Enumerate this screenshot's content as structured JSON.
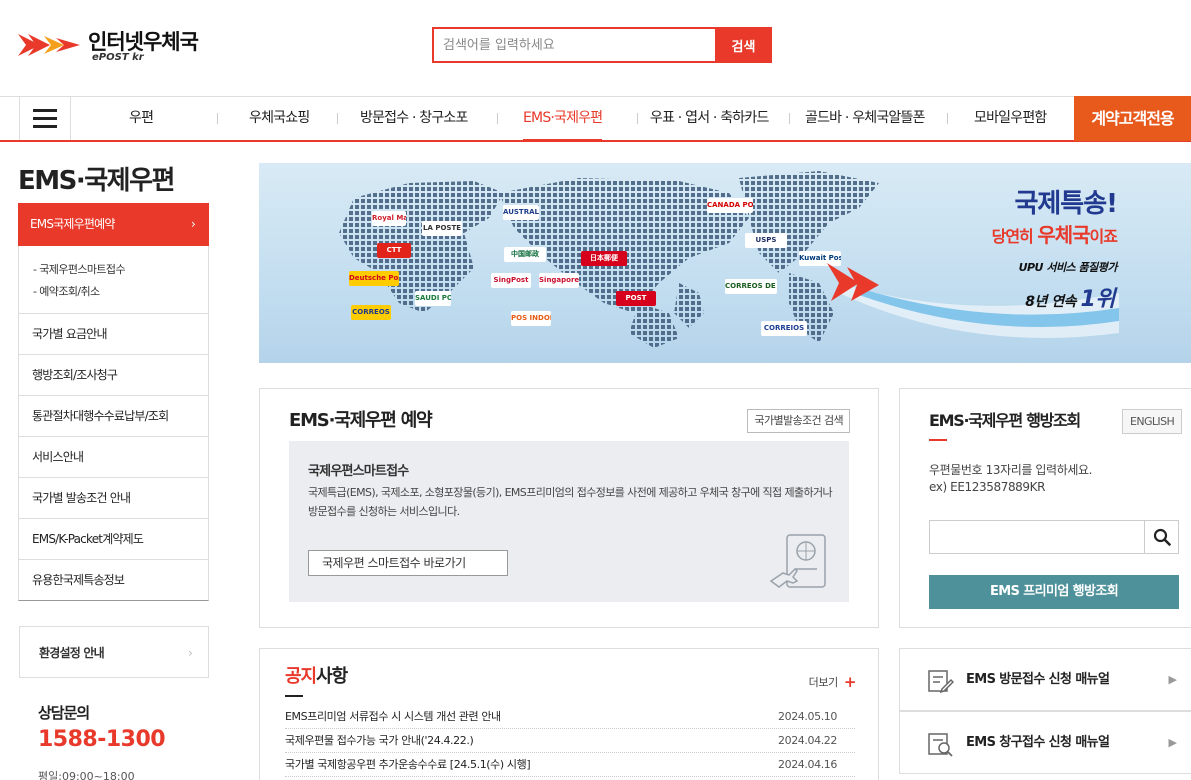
{
  "header": {
    "logo_name": "인터넷우체국",
    "logo_sub": "ePOST kr",
    "search_placeholder": "검색어를 입력하세요",
    "search_button": "검색"
  },
  "gnb": {
    "items": [
      "우편",
      "우체국쇼핑",
      "방문접수 · 창구소포",
      "EMS·국제우편",
      "우표 · 엽서 · 축하카드",
      "골드바 · 우체국알뜰폰",
      "모바일우편함"
    ],
    "active": "EMS·국제우편",
    "contract": "계약고객전용"
  },
  "lnb": {
    "title": "EMS·국제우편",
    "active_item": "EMS국제우편예약",
    "sub_items": [
      "국제우편스마트접수",
      "예약조회/취소"
    ],
    "items": [
      "국가별 요금안내",
      "행방조회/조사청구",
      "통관절차대행수수료납부/조회",
      "서비스안내",
      "국가별 발송조건 안내",
      "EMS/K-Packet계약제도",
      "유용한국제특송정보"
    ],
    "env": "환경설정 안내",
    "consult_label": "상담문의",
    "consult_phone": "1588-1300",
    "consult_hours": "평일:09:00~18:00"
  },
  "banner": {
    "headline": "국제특송!",
    "sub_prefix": "당연히 ",
    "sub_bold": "우체국",
    "sub_suffix": "이죠",
    "upu": "UPU 서비스 품질평가",
    "rank_prefix": "8년 연속 ",
    "rank_bold": "1위",
    "post_logos": [
      "Royal Mail",
      "LA POSTE",
      "CTT",
      "Deutsche Post",
      "SAUDI POST",
      "CORREOS",
      "中国邮政",
      "SingPost",
      "Singapore Post",
      "日本郵便",
      "POST",
      "POS INDONESIA",
      "CANADA POST",
      "AUSTRALIA POST",
      "USPS",
      "CORREOS DE MEXICO",
      "CORREIOS",
      "Kuwait Post"
    ],
    "colors": {
      "red": "#e8392a",
      "navy": "#213a8f"
    }
  },
  "reservation": {
    "title": "EMS·국제우편 예약",
    "cond_button": "국가별발송조건 검색",
    "inner_title": "국제우편스마트접수",
    "inner_desc": "국제특급(EMS), 국제소포, 소형포장물(등기), EMS프리미엄의 접수정보를 사전에 제공하고 우체국 창구에 직접 제출하거나 방문접수를 신청하는 서비스입니다.",
    "inner_button": "국제우편 스마트접수 바로가기"
  },
  "tracking": {
    "title": "EMS·국제우편 행방조회",
    "english": "ENGLISH",
    "help_line1": "우편물번호 13자리를 입력하세요.",
    "help_line2": "ex) EE123587889KR",
    "premium": "EMS 프리미엄 행방조회"
  },
  "notice": {
    "title_hl": "공지",
    "title_rest": "사항",
    "more": "더보기",
    "rows": [
      {
        "title": "EMS프리미엄 서류접수 시 시스템 개선 관련 안내",
        "date": "2024.05.10"
      },
      {
        "title": "국제우편물 접수가능 국가 안내('24.4.22.)",
        "date": "2024.04.22"
      },
      {
        "title": "국가별 국제항공우편 추가운송수수료 [24.5.1(수) 시행]",
        "date": "2024.04.16"
      }
    ]
  },
  "manuals": [
    {
      "label": "EMS 방문접수 신청 매뉴얼"
    },
    {
      "label": "EMS 창구접수 신청 매뉴얼"
    }
  ]
}
